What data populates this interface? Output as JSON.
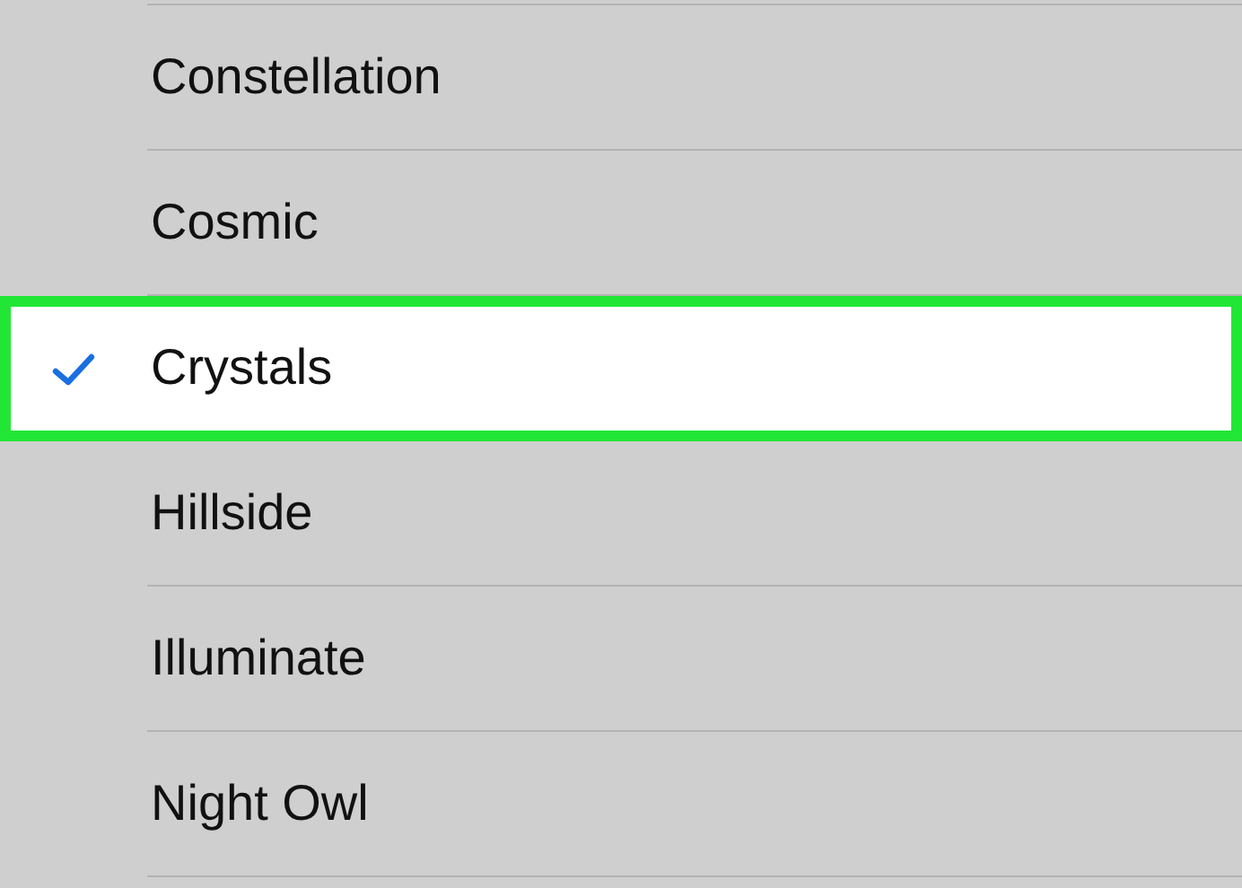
{
  "ringtones": [
    {
      "name": "Constellation",
      "selected": false
    },
    {
      "name": "Cosmic",
      "selected": false
    },
    {
      "name": "Crystals",
      "selected": true
    },
    {
      "name": "Hillside",
      "selected": false
    },
    {
      "name": "Illuminate",
      "selected": false
    },
    {
      "name": "Night Owl",
      "selected": false
    }
  ]
}
